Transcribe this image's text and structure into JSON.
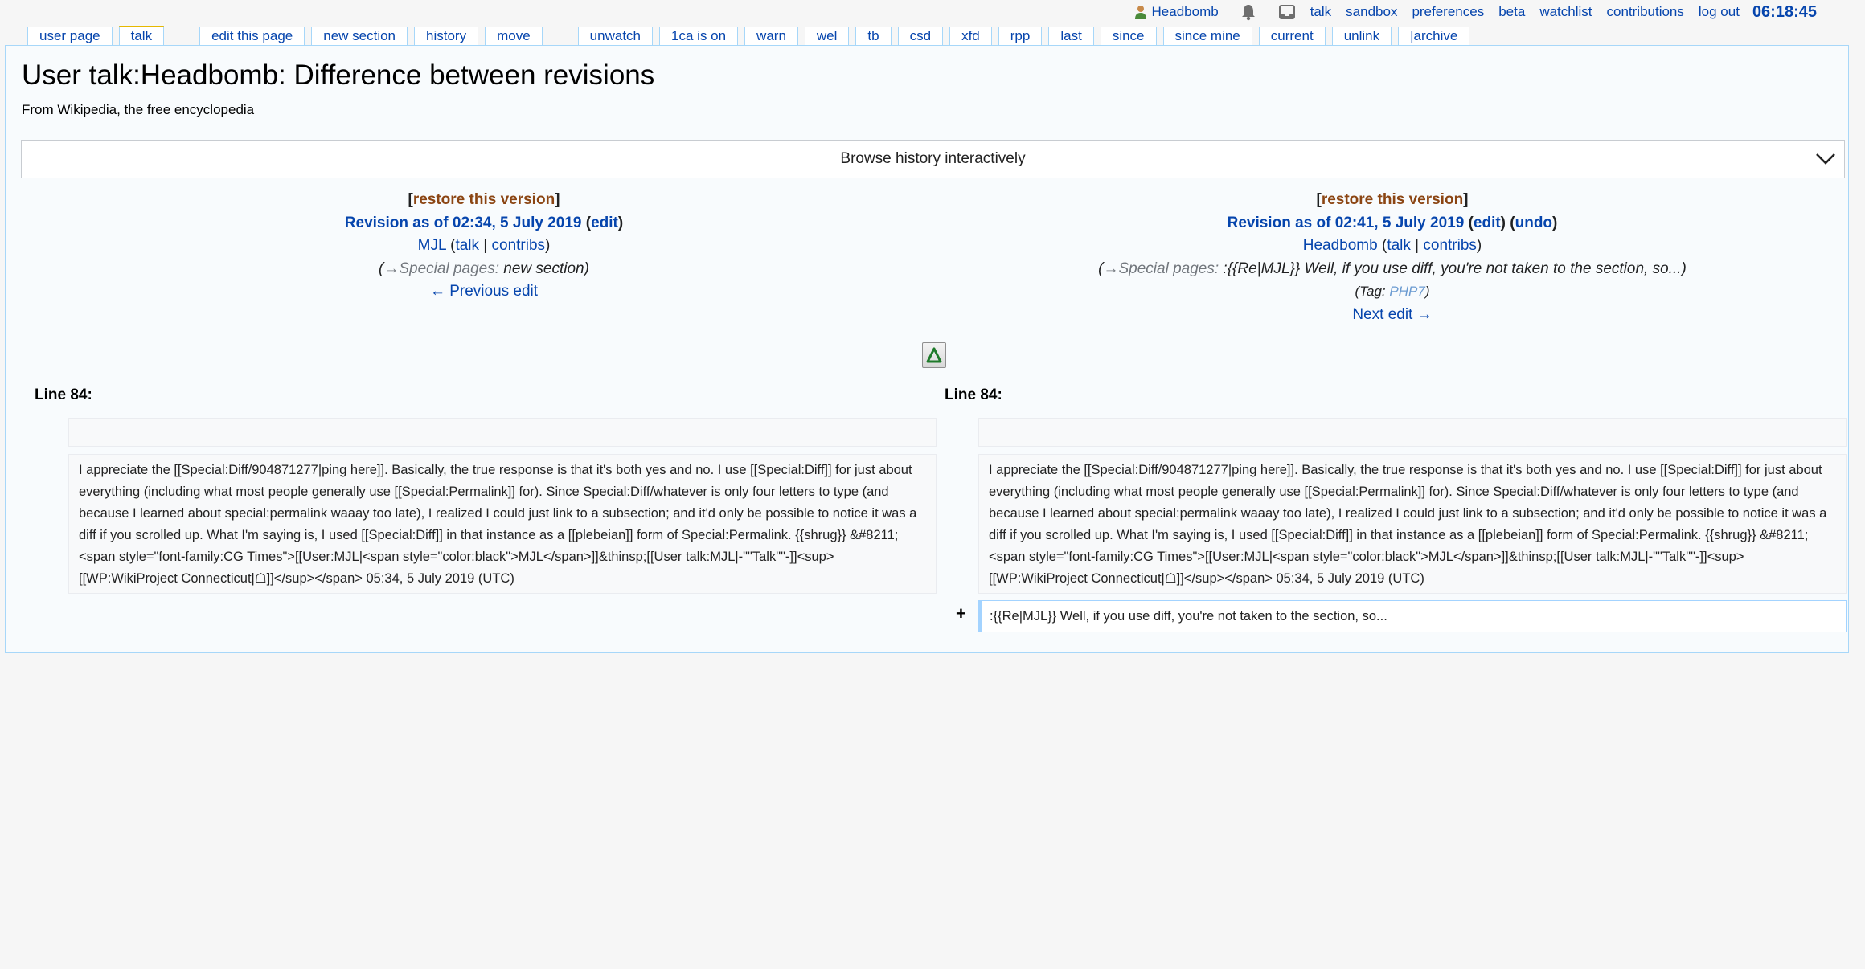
{
  "personal": {
    "username": "Headbomb",
    "links": [
      "talk",
      "sandbox",
      "preferences",
      "beta",
      "watchlist",
      "contributions",
      "log out"
    ],
    "clock": "06:18:45"
  },
  "tabs": {
    "left": [
      "user page",
      "talk"
    ],
    "actions": [
      "edit this page",
      "new section",
      "history",
      "move"
    ],
    "twinkle": [
      "unwatch",
      "1ca is on",
      "warn",
      "wel",
      "tb",
      "csd",
      "xfd",
      "rpp",
      "last",
      "since",
      "since mine",
      "current",
      "unlink",
      "|archive"
    ]
  },
  "page": {
    "title": "User talk:Headbomb: Difference between revisions",
    "site_sub": "From Wikipedia, the free encyclopedia",
    "browse_label": "Browse history interactively"
  },
  "left_rev": {
    "restore": "restore this version",
    "title": "Revision as of 02:34, 5 July 2019",
    "edit": "edit",
    "user": "MJL",
    "talk": "talk",
    "contribs": "contribs",
    "comment_auto": "→Special pages:",
    "comment_text": " new section",
    "nav": "← Previous edit"
  },
  "right_rev": {
    "restore": "restore this version",
    "title": "Revision as of 02:41, 5 July 2019",
    "edit": "edit",
    "undo": "undo",
    "user": "Headbomb",
    "talk": "talk",
    "contribs": "contribs",
    "comment_auto": "→Special pages:",
    "comment_text": " :{{Re|MJL}} Well, if you use diff, you're not taken to the section, so...",
    "tag_label": "Tag:",
    "tag": "PHP7",
    "nav": "Next edit →"
  },
  "diff": {
    "line_left": "Line 84:",
    "line_right": "Line 84:",
    "context_text": "I appreciate the [[Special:Diff/904871277|ping here]]. Basically, the true response is that it's both yes and no. I use [[Special:Diff]] for just about everything (including what most people generally use [[Special:Permalink]] for). Since Special:Diff/whatever is only four letters to type (and because I learned about special:permalink waaay too late), I realized I could just link to a subsection; and it'd only be possible to notice it was a diff if you scrolled up. What I'm saying is, I used [[Special:Diff]] in that instance as a [[plebeian]] form of Special:Permalink. {{shrug}} &#8211;<span style=\"font-family:CG Times\">[[User:MJL|<span style=\"color:black\">MJL</span>]]&thinsp;[[User talk:MJL|-\"\"Talk\"\"-]]<sup>[[WP:WikiProject Connecticut|☖]]</sup></span> 05:34, 5 July 2019 (UTC)",
    "added_marker": "+",
    "added_text": ":{{Re|MJL}} Well, if you use diff, you're not taken to the section, so..."
  },
  "icons": {
    "user": "user-icon",
    "notifications": "bell-icon",
    "messages": "tray-icon",
    "expand": "chevron-down-icon",
    "diff_toggle": "delta-icon"
  }
}
